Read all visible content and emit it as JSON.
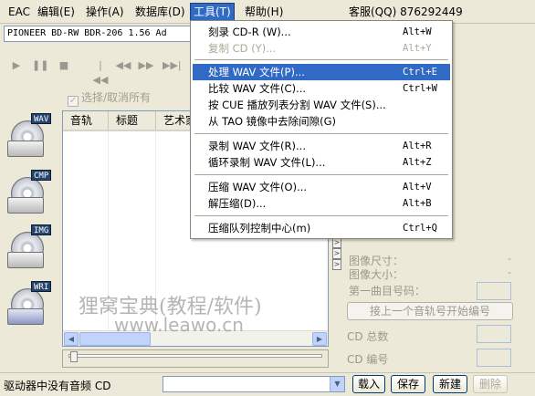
{
  "menubar": {
    "items": [
      {
        "label": "EAC"
      },
      {
        "label": "编辑(E)"
      },
      {
        "label": "操作(A)"
      },
      {
        "label": "数据库(D)"
      },
      {
        "label": "工具(T)"
      },
      {
        "label": "帮助(H)"
      }
    ],
    "qq_info": "客服(QQ) 876292449"
  },
  "drive": {
    "selected": "PIONEER BD-RW   BDR-206 1.56  Ad"
  },
  "transport_icons": [
    "play-icon",
    "pause-icon",
    "stop-icon",
    "previous-track-icon",
    "rewind-icon",
    "fast-forward-icon",
    "next-track-icon"
  ],
  "select_all": {
    "label": "选择/取消所有"
  },
  "side_tools": [
    {
      "tag": "WAV"
    },
    {
      "tag": "CMP"
    },
    {
      "tag": "IMG"
    },
    {
      "tag": "WRI"
    }
  ],
  "tracklist": {
    "columns": [
      "音轨",
      "标题",
      "艺术家"
    ]
  },
  "right_panel": {
    "image_size_label": "图像尺寸：",
    "image_size_value": "-",
    "image_length_label": "图像大小：",
    "image_length_value": "-",
    "first_track_label": "第一曲目号码：",
    "next_track_button": "接上一个音轨号开始编号",
    "cd_total_label": "CD 总数",
    "cd_number_label": "CD 编号"
  },
  "watermark": {
    "line1": "狸窝宝典(教程/软件)",
    "line2": "www.leawo.cn"
  },
  "statusbar": {
    "text": "驱动器中没有音频 CD",
    "buttons": [
      "载入",
      "保存",
      "新建",
      "删除"
    ]
  },
  "tools_menu": {
    "items": [
      {
        "label": "刻录 CD-R (W)...",
        "shortcut": "Alt+W",
        "state": "normal"
      },
      {
        "label": "复制 CD (Y)...",
        "shortcut": "Alt+Y",
        "state": "disabled"
      },
      {
        "label": "处理 WAV 文件(P)...",
        "shortcut": "Ctrl+E",
        "state": "highlighted"
      },
      {
        "label": "比较 WAV 文件(C)...",
        "shortcut": "Ctrl+W",
        "state": "normal"
      },
      {
        "label": "按 CUE 播放列表分割 WAV 文件(S)...",
        "shortcut": "",
        "state": "normal"
      },
      {
        "label": "从 TAO 镜像中去除间隙(G)",
        "shortcut": "",
        "state": "normal"
      },
      {
        "label": "录制 WAV 文件(R)...",
        "shortcut": "Alt+R",
        "state": "normal"
      },
      {
        "label": "循环录制 WAV 文件(L)...",
        "shortcut": "Alt+Z",
        "state": "normal"
      },
      {
        "label": "压缩 WAV 文件(O)...",
        "shortcut": "Alt+V",
        "state": "normal"
      },
      {
        "label": "解压缩(D)...",
        "shortcut": "Alt+B",
        "state": "normal"
      },
      {
        "label": "压缩队列控制中心(m)",
        "shortcut": "Ctrl+Q",
        "state": "normal"
      }
    ]
  }
}
